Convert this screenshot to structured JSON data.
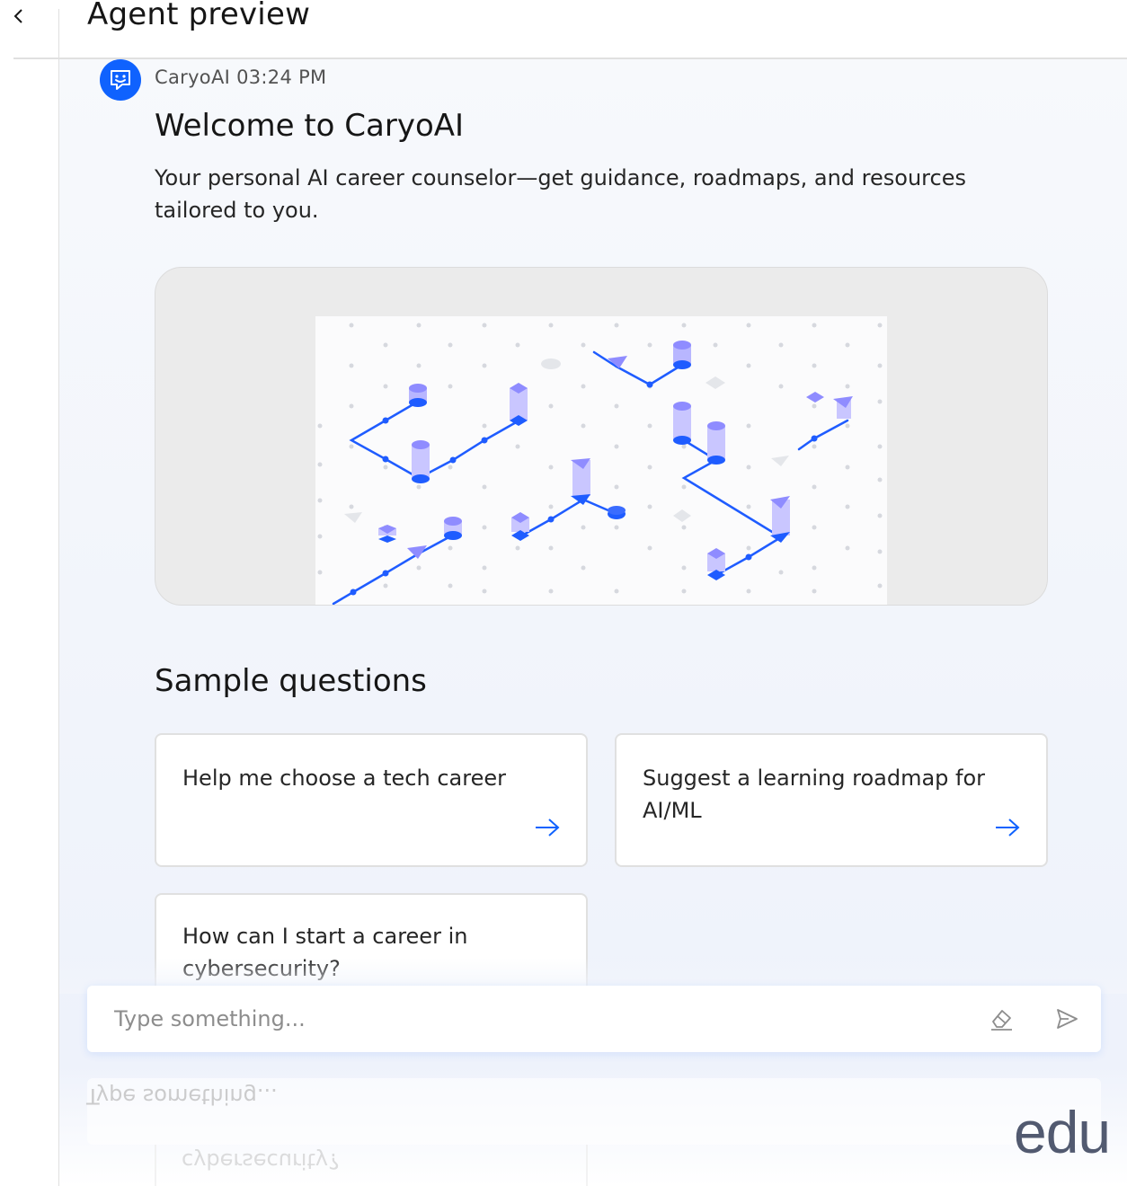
{
  "header": {
    "title": "Agent preview"
  },
  "message": {
    "sender": "CaryoAI",
    "time": "03:24 PM",
    "title": "Welcome to CaryoAI",
    "body": "Your personal AI career counselor—get guidance, roadmaps, and resources tailored to you."
  },
  "sample_questions": {
    "title": "Sample questions",
    "items": [
      {
        "label": "Help me choose a tech career"
      },
      {
        "label": "Suggest a learning roadmap for AI/ML"
      },
      {
        "label": "How can I start a career in cybersecurity?"
      }
    ]
  },
  "input": {
    "placeholder": "Type something..."
  },
  "reflection": {
    "input_text": "Type something...",
    "card_text": "cybersecurity?"
  },
  "watermark": "edu",
  "colors": {
    "accent": "#0f62fe",
    "illustration_blue": "#1f5cff",
    "illustration_purple": "#8f8cff"
  },
  "icons": {
    "back": "chevron-left-icon",
    "avatar": "chat-bot-icon",
    "arrow": "arrow-right-icon",
    "clear": "eraser-icon",
    "send": "send-icon"
  }
}
